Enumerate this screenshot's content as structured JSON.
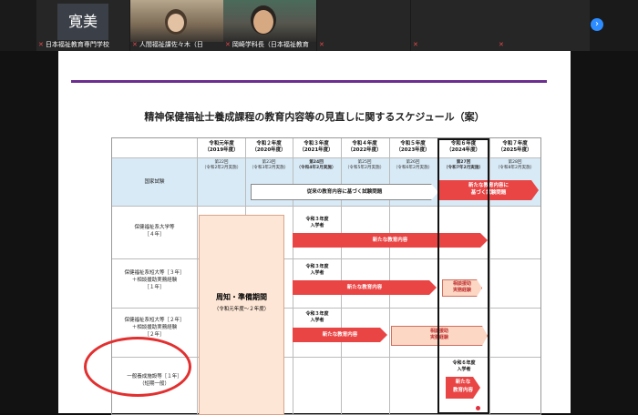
{
  "participants": [
    {
      "name": "日本福祉教育専門学校",
      "avatar_text": "寛美"
    },
    {
      "name": "人間福祉課佐々木（日"
    },
    {
      "name": "岡崎学科長（日本福祉教育"
    },
    {
      "name": ""
    },
    {
      "name": ""
    },
    {
      "name": ""
    }
  ],
  "slide": {
    "title": "精神保健福祉士養成課程の教育内容等の見直しに関するスケジュール（案）",
    "years": [
      {
        "era": "令和元年度",
        "year": "（2019年度）"
      },
      {
        "era": "令和２年度",
        "year": "（2020年度）"
      },
      {
        "era": "令和３年度",
        "year": "（2021年度）"
      },
      {
        "era": "令和４年度",
        "year": "（2022年度）"
      },
      {
        "era": "令和５年度",
        "year": "（2023年度）"
      },
      {
        "era": "令和６年度",
        "year": "（2024年度）"
      },
      {
        "era": "令和７年度",
        "year": "（2025年度）"
      }
    ],
    "exams": [
      {
        "no": "第22回",
        "when": "（令和2年2月実施）"
      },
      {
        "no": "第23回",
        "when": "（令和3年2月実施）"
      },
      {
        "no": "第24回",
        "when": "（令和4年2月実施）"
      },
      {
        "no": "第25回",
        "when": "（令和5年2月実施）"
      },
      {
        "no": "第26回",
        "when": "（令和6年2月実施）"
      },
      {
        "no": "第27回",
        "when": "（令和7年2月実施）"
      },
      {
        "no": "第28回",
        "when": "（令和8年2月実施）"
      }
    ],
    "rows": {
      "exam": "国家試験",
      "univ": "保健福祉系大学等\n［４年］",
      "short3": "保健福祉系短大等［３年］\n＋相談援助実務経験\n［１年］",
      "short2": "保健福祉系短大等［２年］\n＋相談援助実務経験\n［２年］",
      "general": "一般養成施設等［１年］\n（短期一般）"
    },
    "old_exam_arrow": "従来の教育内容に基づく試験問題",
    "new_exam_arrow": "新たな教育内容に\n基づく試験問題",
    "prep_title": "周知・準備期間",
    "prep_sub": "（令和元年度～２年度）",
    "entrants_r3": "令和３年度\n入学者",
    "entrants_r6": "令和６年度\n入学者",
    "new_content": "新たな教育内容",
    "practice": "相談援助\n実務経験",
    "new_content_short": "新たな\n教育内容"
  },
  "colors": {
    "accent_purple": "#6b2e8f",
    "arrow_red": "#e94545",
    "highlight_oval": "#e23030"
  }
}
